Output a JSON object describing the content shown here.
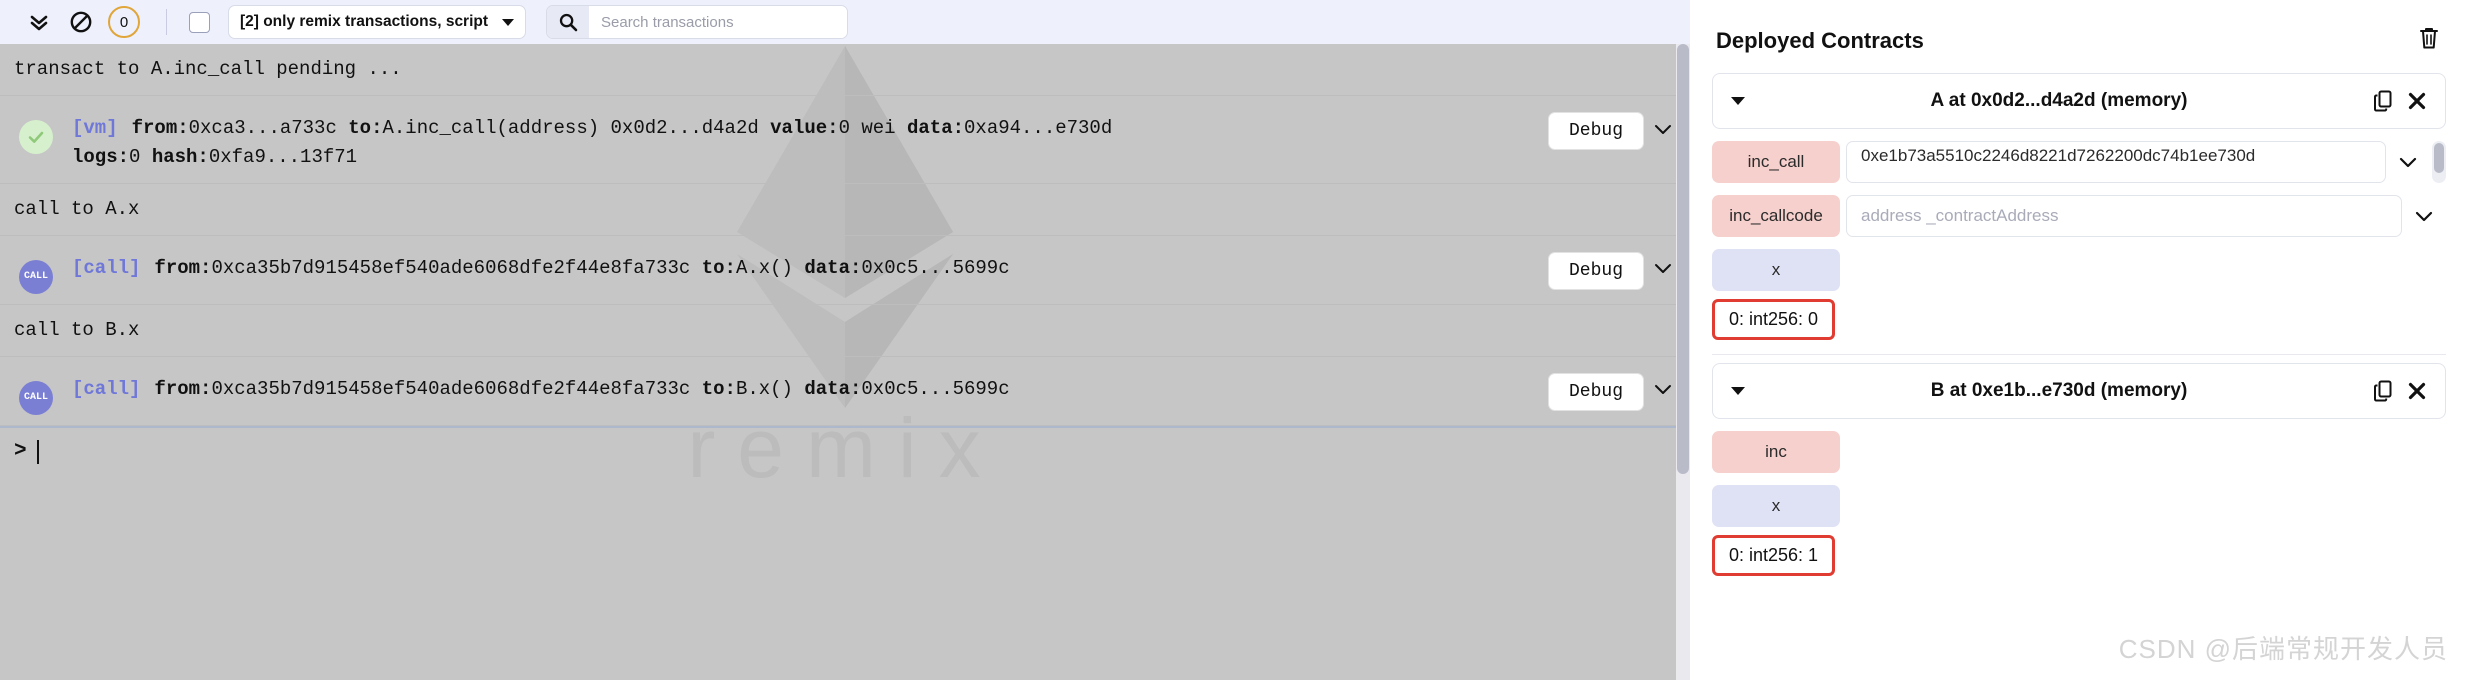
{
  "toolbar": {
    "collapse_all_icon": "double-chevron-down-icon",
    "clear_icon": "ban-circle-icon",
    "pending_count": "0",
    "checkbox_checked": false,
    "filter_label": "[2] only remix transactions, script",
    "search_icon": "search-icon",
    "search_placeholder": "Search transactions",
    "search_value": ""
  },
  "terminal": {
    "watermark_text": "remix",
    "lines": [
      {
        "type": "plain",
        "text": "transact to A.inc_call pending ..."
      }
    ],
    "transaction": {
      "status_icon": "check-circle-icon",
      "tag": "[vm]",
      "line1": [
        {
          "label": "from:",
          "value": "0xca3...a733c"
        },
        {
          "label": "to:",
          "value": "A.inc_call(address) 0x0d2...d4a2d"
        },
        {
          "label": "value:",
          "value": "0 wei"
        },
        {
          "label": "data:",
          "value": "0xa94...e730d"
        }
      ],
      "line2": [
        {
          "label": "logs:",
          "value": "0"
        },
        {
          "label": "hash:",
          "value": "0xfa9...13f71"
        }
      ],
      "debug_label": "Debug",
      "expand_icon": "chevron-down-icon"
    },
    "call_a": {
      "header": "call to A.x",
      "avatar": "CALL",
      "tag": "[call]",
      "parts": [
        {
          "label": "from:",
          "value": "0xca35b7d915458ef540ade6068dfe2f44e8fa733c"
        },
        {
          "label": "to:",
          "value": "A.x()"
        },
        {
          "label": "data:",
          "value": "0x0c5...5699c"
        }
      ],
      "debug_label": "Debug",
      "expand_icon": "chevron-down-icon"
    },
    "call_b": {
      "header": "call to B.x",
      "avatar": "CALL",
      "tag": "[call]",
      "parts": [
        {
          "label": "from:",
          "value": "0xca35b7d915458ef540ade6068dfe2f44e8fa733c"
        },
        {
          "label": "to:",
          "value": "B.x()"
        },
        {
          "label": "data:",
          "value": "0x0c5...5699c"
        }
      ],
      "debug_label": "Debug",
      "expand_icon": "chevron-down-icon"
    },
    "prompt_symbol": ">",
    "prompt_value": ""
  },
  "deployed": {
    "title": "Deployed Contracts",
    "trash_icon": "trash-icon",
    "contracts": [
      {
        "collapse_icon": "triangle-down-icon",
        "name": "A at 0x0d2...d4a2d (memory)",
        "copy_icon": "copy-icon",
        "close_icon": "close-icon",
        "functions": [
          {
            "label": "inc_call",
            "kind": "transact",
            "input_value": "0xe1b73a5510c2246d8221d7262200dc74b1ee730d",
            "input_placeholder": "",
            "expand_icon": "chevron-down-icon",
            "has_scrollbar": true
          },
          {
            "label": "inc_callcode",
            "kind": "transact",
            "input_value": "",
            "input_placeholder": "address _contractAddress",
            "expand_icon": "chevron-down-icon",
            "has_scrollbar": false
          },
          {
            "label": "x",
            "kind": "call",
            "result": "0: int256: 0"
          }
        ]
      },
      {
        "collapse_icon": "triangle-down-icon",
        "name": "B at 0xe1b...e730d (memory)",
        "copy_icon": "copy-icon",
        "close_icon": "close-icon",
        "functions": [
          {
            "label": "inc",
            "kind": "transact"
          },
          {
            "label": "x",
            "kind": "call",
            "result": "0: int256: 1"
          }
        ]
      }
    ],
    "watermark": "CSDN @后端常规开发人员"
  },
  "colors": {
    "toolbar_bg": "#eef0fb",
    "terminal_bg": "#c6c6c6",
    "transact_btn": "#f6d0cc",
    "call_btn": "#dfe1f5",
    "result_border": "#e03c31",
    "badge_border": "#e0a63a",
    "vm_tag": "#6f77d8"
  }
}
